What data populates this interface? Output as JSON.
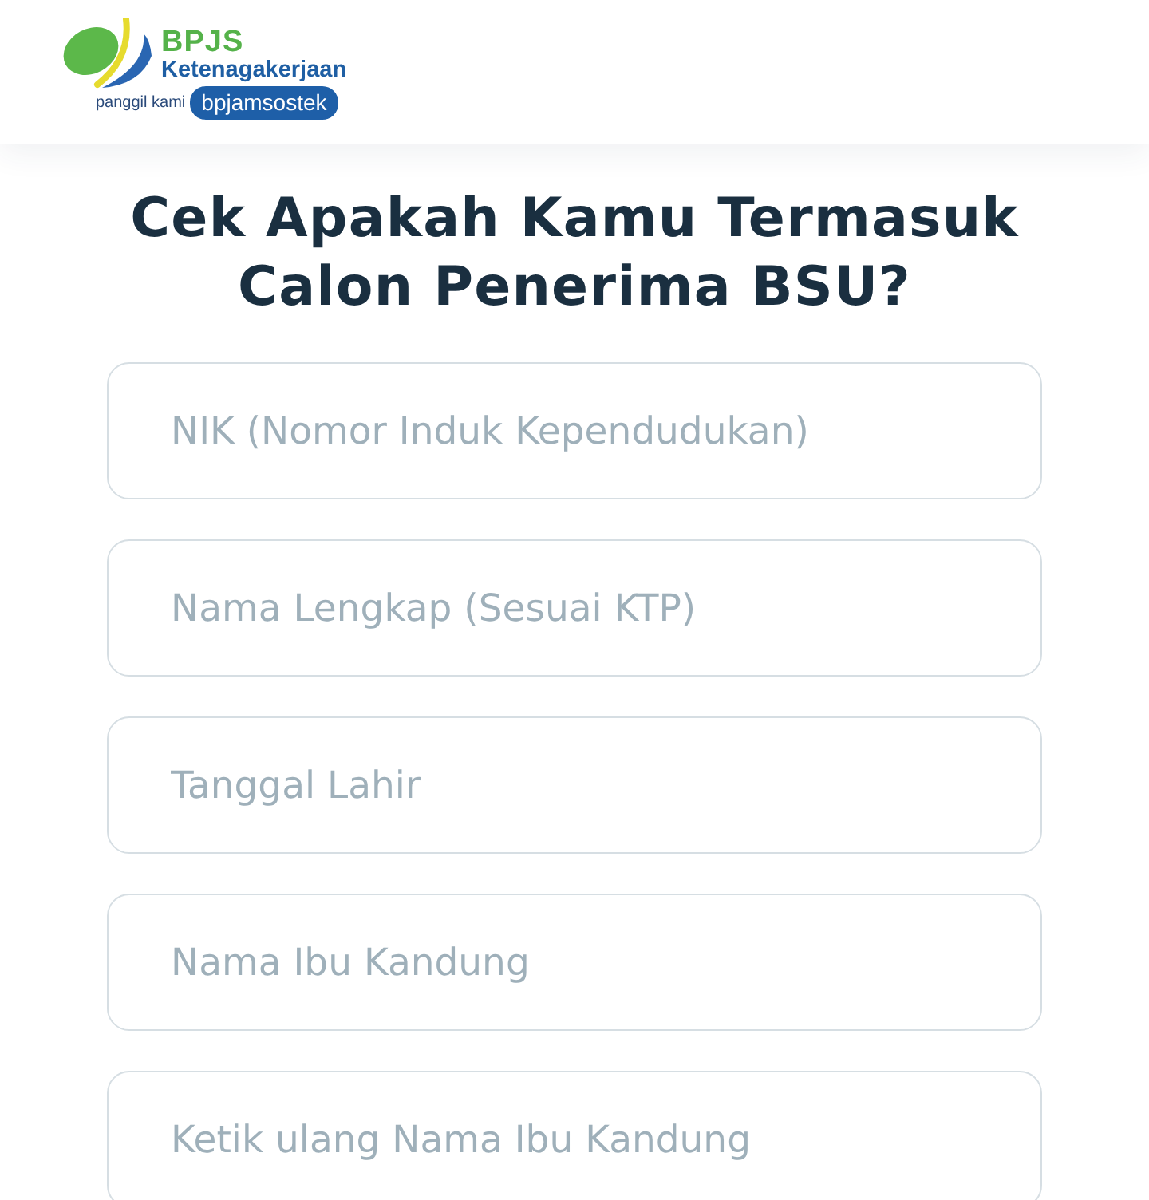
{
  "header": {
    "brand": "BPJS",
    "subtitle": "Ketenagakerjaan",
    "tagline": "panggil kami",
    "badge": "bpjamsostek"
  },
  "title": "Cek Apakah Kamu Termasuk Calon Penerima BSU?",
  "fields": [
    {
      "placeholder": "NIK (Nomor Induk Kependudukan)"
    },
    {
      "placeholder": "Nama Lengkap (Sesuai KTP)"
    },
    {
      "placeholder": "Tanggal Lahir"
    },
    {
      "placeholder": "Nama Ibu Kandung"
    },
    {
      "placeholder": "Ketik ulang Nama Ibu Kandung"
    }
  ]
}
